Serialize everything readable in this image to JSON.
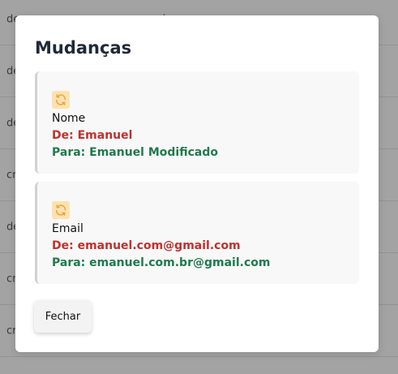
{
  "background": {
    "rows": [
      {
        "col1": "de",
        "col2": "d"
      },
      {
        "col1": "de",
        "col2": ""
      },
      {
        "col1": "de",
        "col2": ""
      },
      {
        "col1": "cr",
        "col2": ""
      },
      {
        "col1": "de",
        "col2": ""
      },
      {
        "col1": "cr",
        "col2": ""
      },
      {
        "col1": "cr",
        "col2": ""
      }
    ]
  },
  "modal": {
    "title": "Mudanças",
    "changes": [
      {
        "icon": "refresh-icon",
        "field": "Nome",
        "from": "De: Emanuel",
        "to": "Para: Emanuel Modificado"
      },
      {
        "icon": "refresh-icon",
        "field": "Email",
        "from": "De: emanuel.com@gmail.com",
        "to": "Para: emanuel.com.br@gmail.com"
      }
    ],
    "close_label": "Fechar"
  },
  "colors": {
    "backdrop": "#a3a3a3",
    "from_text": "#c0302d",
    "to_text": "#1f7a4d",
    "icon_background": "#fde2b0",
    "icon_stroke": "#f0a030"
  }
}
